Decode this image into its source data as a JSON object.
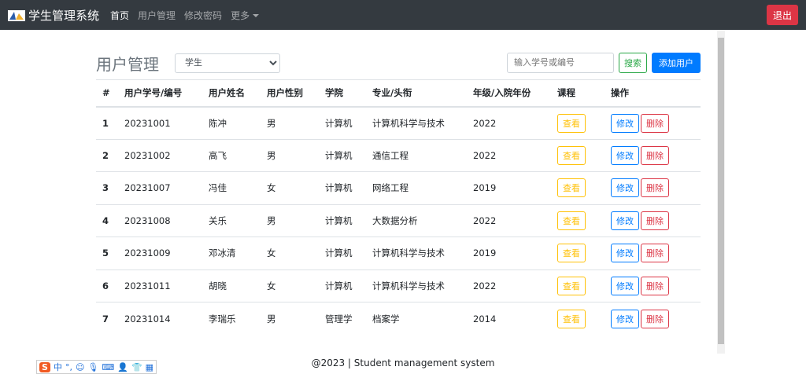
{
  "nav": {
    "brand": "学生管理系统",
    "items": [
      "首页",
      "用户管理",
      "修改密码",
      "更多"
    ],
    "logout": "退出"
  },
  "main": {
    "title": "用户管理",
    "role_select": "学生",
    "search_placeholder": "输入学号或编号",
    "search_btn": "搜索",
    "add_btn": "添加用户"
  },
  "table": {
    "headers": [
      "#",
      "用户学号/编号",
      "用户姓名",
      "用户性别",
      "学院",
      "专业/头衔",
      "年级/入院年份",
      "课程",
      "操作"
    ],
    "rows": [
      [
        "1",
        "20231001",
        "陈冲",
        "男",
        "计算机",
        "计算机科学与技术",
        "2022"
      ],
      [
        "2",
        "20231002",
        "高飞",
        "男",
        "计算机",
        "通信工程",
        "2022"
      ],
      [
        "3",
        "20231007",
        "冯佳",
        "女",
        "计算机",
        "网络工程",
        "2019"
      ],
      [
        "4",
        "20231008",
        "关乐",
        "男",
        "计算机",
        "大数据分析",
        "2022"
      ],
      [
        "5",
        "20231009",
        "邓冰清",
        "女",
        "计算机",
        "计算机科学与技术",
        "2019"
      ],
      [
        "6",
        "20231011",
        "胡晓",
        "女",
        "计算机",
        "计算机科学与技术",
        "2022"
      ],
      [
        "7",
        "20231014",
        "李瑞乐",
        "男",
        "管理学",
        "档案学",
        "2014"
      ]
    ],
    "view": "查看",
    "edit": "修改",
    "delete": "删除"
  },
  "footer": "@2023 | Student management system",
  "ime": {
    "logo": "S",
    "lang": "中"
  }
}
